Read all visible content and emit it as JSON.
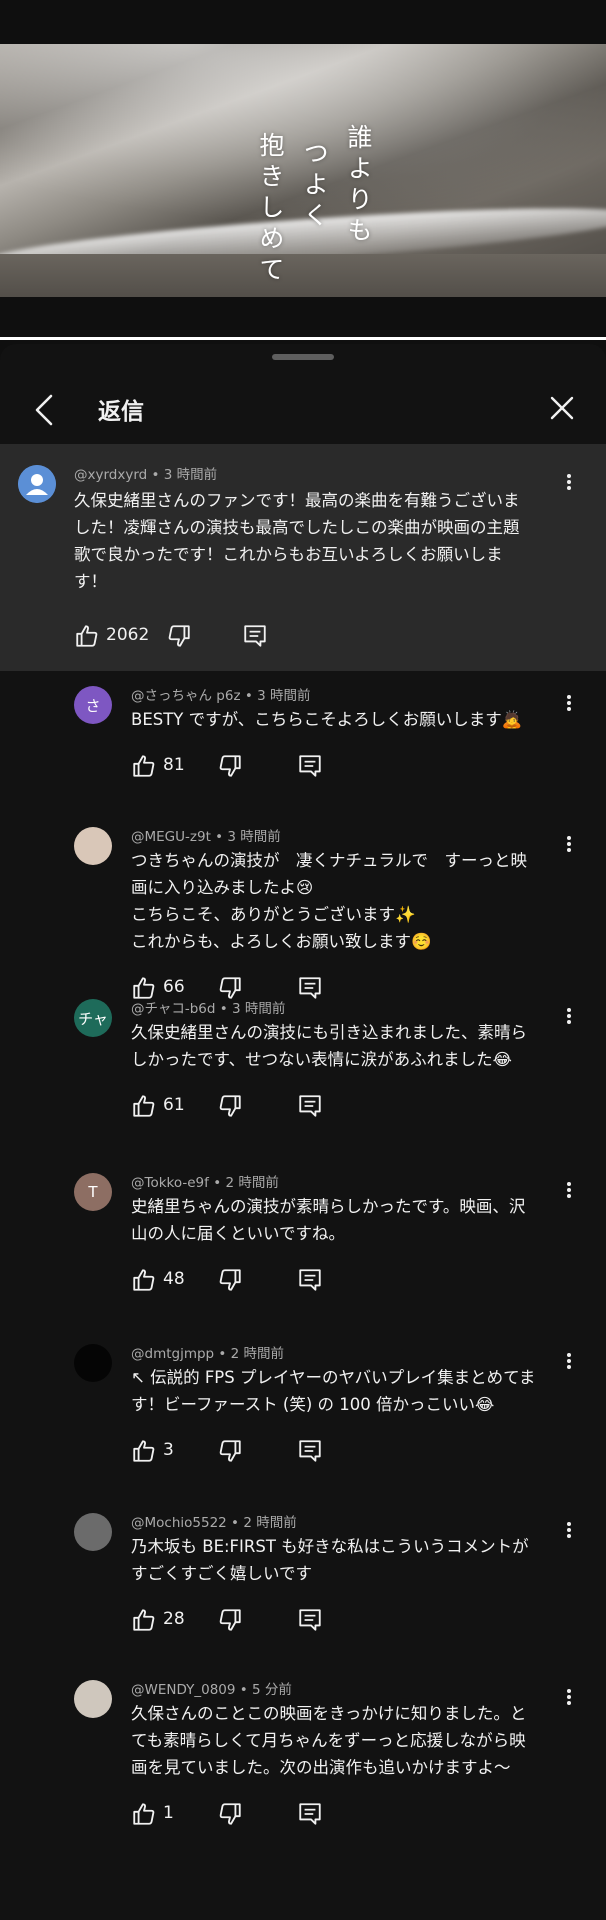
{
  "video": {
    "lyric_lines": [
      "誰よりも",
      "つよく",
      "抱きしめて"
    ]
  },
  "header": {
    "title": "返信"
  },
  "parent_comment": {
    "author": "@xyrdxyrd",
    "time": "3 時間前",
    "text_lines": [
      "久保史緒里さんのファンです！最高の楽曲を有難うございま",
      "した！凌輝さんの演技も最高でしたしこの楽曲が映画の主題",
      "歌で良かったです！これからもお互いよろしくお願いしま",
      "す！"
    ],
    "likes": "2062",
    "avatar_icon": "default-user-icon",
    "avatar_color": "#5b8fd6"
  },
  "replies": [
    {
      "author": "@さっちゃん p6z",
      "time": "3 時間前",
      "text_lines": [
        "BESTY ですが、こちらこそよろしくお願いします🙇"
      ],
      "likes": "81",
      "avatar_letter": "さ",
      "avatar_color": "#7e57c2"
    },
    {
      "author": "@MEGU-z9t",
      "time": "3 時間前",
      "text_lines": [
        "つきちゃんの演技が　凄くナチュラルで　すーっと映",
        "画に入り込みましたよ😢",
        "こちらこそ、ありがとうございます✨",
        "これからも、よろしくお願い致します☺️"
      ],
      "likes": "66",
      "avatar_letter": "",
      "avatar_color": "#d9c7b8"
    },
    {
      "author": "@チャコ-b6d",
      "time": "3 時間前",
      "text_lines": [
        "久保史緒里さんの演技にも引き込まれました、素晴ら",
        "しかったです、せつない表情に涙があふれました😂"
      ],
      "likes": "61",
      "avatar_letter": "チャ",
      "avatar_color": "#1e6b5a"
    },
    {
      "author": "@Tokko-e9f",
      "time": "2 時間前",
      "text_lines": [
        "史緒里ちゃんの演技が素晴らしかったです。映画、沢",
        "山の人に届くといいですね。"
      ],
      "likes": "48",
      "avatar_letter": "T",
      "avatar_color": "#8d6e63"
    },
    {
      "author": "@dmtgjmpp",
      "time": "2 時間前",
      "text_lines": [
        "↖ 伝説的 FPS プレイヤーのヤバいプレイ集まとめてま",
        "す！ビーファースト (笑) の 100 倍かっこいい😂"
      ],
      "likes": "3",
      "avatar_letter": "",
      "avatar_color": "#050505"
    },
    {
      "author": "@Mochio5522",
      "time": "2 時間前",
      "text_lines": [
        "乃木坂も BE:FIRST も好きな私はこういうコメントが",
        "すごくすごく嬉しいです"
      ],
      "likes": "28",
      "avatar_letter": "",
      "avatar_color": "#6b6b6b"
    },
    {
      "author": "@WENDY_0809",
      "time": "5 分前",
      "text_lines": [
        "久保さんのことこの映画をきっかけに知りました。と",
        "ても素晴らしくて月ちゃんをずーっと応援しながら映",
        "画を見ていました。次の出演作も追いかけますよ〜"
      ],
      "likes": "1",
      "avatar_letter": "",
      "avatar_color": "#cfc7bd"
    }
  ]
}
